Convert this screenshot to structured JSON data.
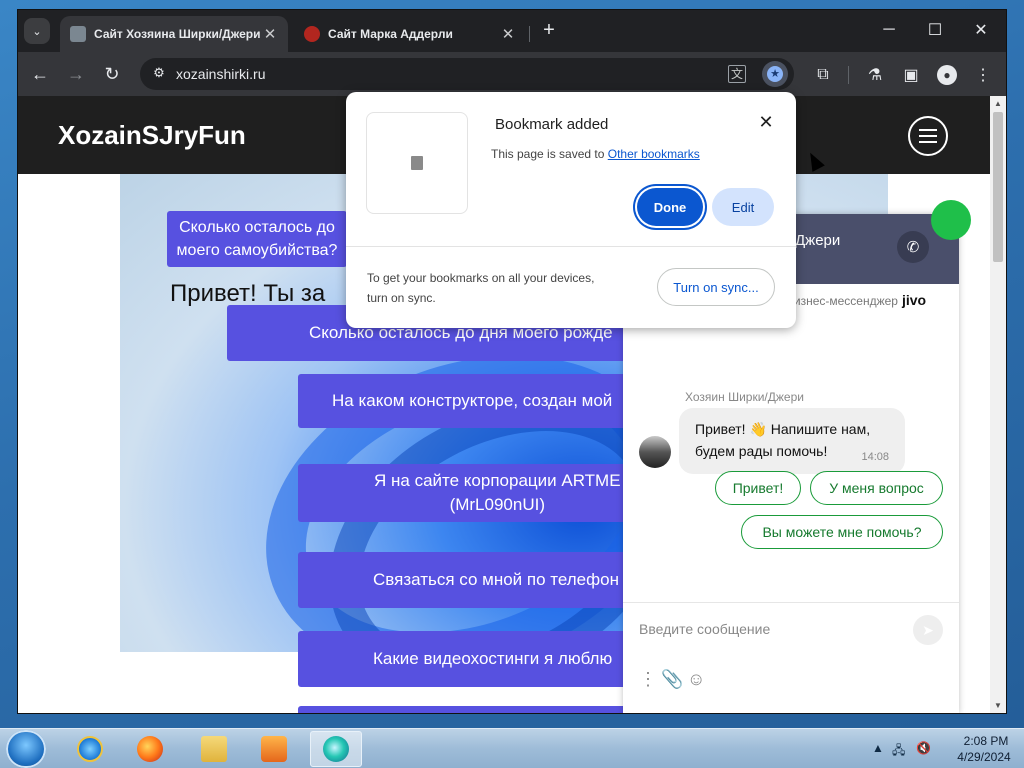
{
  "browser": {
    "tabs": [
      {
        "title": "Сайт Хозяина Ширки/Джери",
        "active": true
      },
      {
        "title": "Сайт Марка Аддерли",
        "active": false
      }
    ],
    "new_tab_label": "+",
    "url": "xozainshirki.ru",
    "icons": {
      "tab_search": "chevron-down-icon",
      "back": "back-arrow-icon",
      "forward": "forward-arrow-icon",
      "reload": "reload-icon",
      "site_info": "tune-icon",
      "translate": "translate-icon",
      "bookmark": "star-icon",
      "extensions": "puzzle-icon",
      "labs": "flask-icon",
      "side_panel": "side-panel-icon",
      "profile": "profile-icon",
      "menu": "kebab-menu-icon"
    }
  },
  "window_controls": {
    "minimize": "─",
    "maximize": "☐",
    "close": "✕"
  },
  "bookmark_bubble": {
    "title": "Bookmark added",
    "saved_prefix": "This page is saved to ",
    "saved_link": "Other bookmarks",
    "done_label": "Done",
    "edit_label": "Edit",
    "sync_text": "To get your bookmarks on all your devices, turn on sync.",
    "sync_button": "Turn on sync..."
  },
  "site": {
    "logo": "XozainSJryFun",
    "heading": "Привет! Ты за",
    "buttons": [
      "Сколько осталось до моего самоубийства?",
      "Сколько осталось до дня моего рожде",
      "На каком конструкторе, создан мой",
      "Я на сайте корпорации ARTME\n(MrL090nUI)",
      "Связаться со мной по телефон",
      "Какие видеохостинги я люблю"
    ]
  },
  "chat": {
    "agent_name": "Джери",
    "brand_text": "бизнес-мессенджер",
    "brand_logo": "jivo",
    "sender": "Хозяин Ширки/Джери",
    "message": "Привет! 👋 Напишите нам, будем рады помочь!",
    "time": "14:08",
    "quick_replies": [
      "Привет!",
      "У меня вопрос",
      "Вы можете мне помочь?"
    ],
    "input_placeholder": "Введите сообщение",
    "accent_color": "#1a9b3a"
  },
  "taskbar": {
    "apps": [
      "internet-explorer",
      "firefox",
      "file-explorer",
      "media-player",
      "chrome"
    ],
    "clock_time": "2:08 PM",
    "clock_date": "4/29/2024"
  }
}
